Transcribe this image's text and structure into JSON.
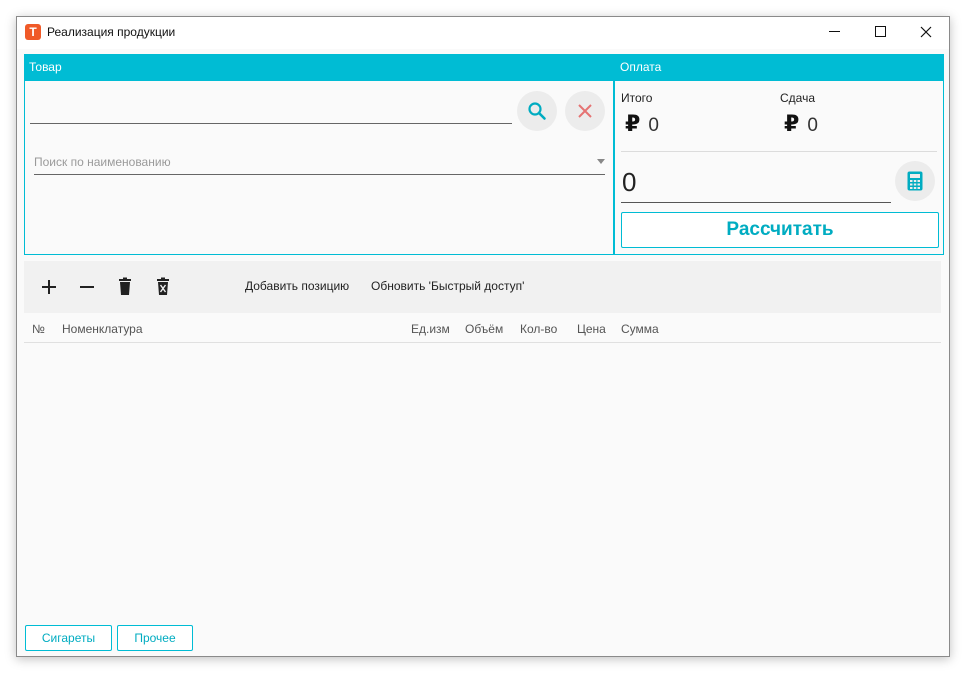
{
  "window": {
    "title": "Реализация продукции",
    "icon_letter": "T"
  },
  "goods": {
    "header": "Товар",
    "search_placeholder": "Поиск по наименованию"
  },
  "payment": {
    "header": "Оплата",
    "total_label": "Итого",
    "total_value": "0",
    "change_label": "Сдача",
    "change_value": "0",
    "currency_symbol": "₽",
    "amount_value": "0",
    "calculate_label": "Рассчитать"
  },
  "toolbar": {
    "add_position": "Добавить позицию",
    "refresh_quick_access": "Обновить 'Быстрый доступ'"
  },
  "table": {
    "columns": [
      "№",
      "Номенклатура",
      "Ед.изм",
      "Объём",
      "Кол-во",
      "Цена",
      "Сумма"
    ]
  },
  "quick_access": {
    "buttons": [
      "Сигареты",
      "Прочее"
    ]
  },
  "colors": {
    "accent": "#00bcd4",
    "accent_text": "#00acc1",
    "clear_icon": "#e57373",
    "app_icon": "#f05a28"
  }
}
